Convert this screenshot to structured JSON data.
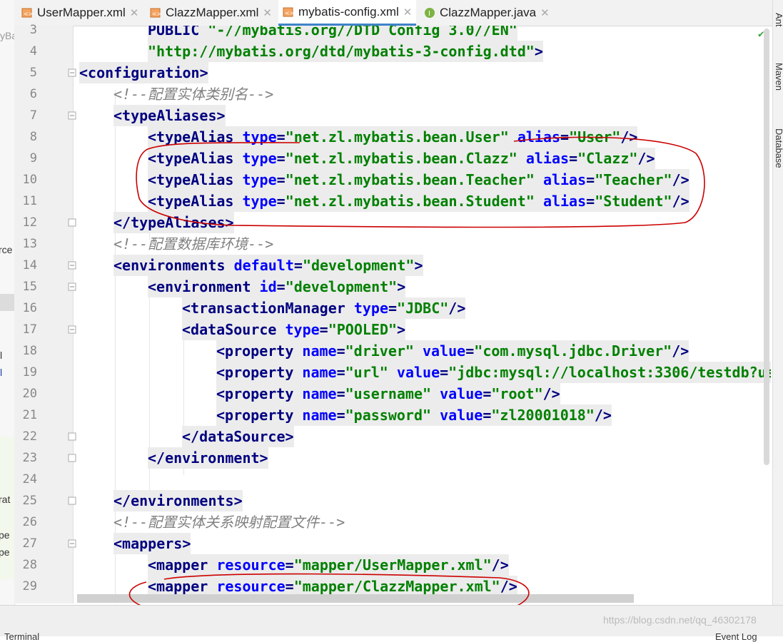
{
  "tabs": [
    {
      "label": "UserMapper.xml",
      "icon": "xml-file-icon",
      "active": false
    },
    {
      "label": "ClazzMapper.xml",
      "icon": "xml-file-icon",
      "active": false
    },
    {
      "label": "mybatis-config.xml",
      "icon": "xml-file-icon",
      "active": true
    },
    {
      "label": "ClazzMapper.java",
      "icon": "interface-file-icon",
      "active": false
    }
  ],
  "left_panel_fragments": [
    "yBa",
    "rce",
    "l",
    "l",
    "rat",
    "pe",
    "pe"
  ],
  "right_panel": {
    "tools": [
      "Ant",
      "Maven",
      "Database"
    ]
  },
  "line_numbers": [
    "3",
    "4",
    "5",
    "6",
    "7",
    "8",
    "9",
    "10",
    "11",
    "12",
    "13",
    "14",
    "15",
    "16",
    "17",
    "18",
    "19",
    "20",
    "21",
    "22",
    "23",
    "24",
    "25",
    "26",
    "27",
    "28",
    "29"
  ],
  "code": {
    "l3": {
      "public": "PUBLIC",
      "public_id": "\"-//mybatis.org//DTD Config 3.0//EN\""
    },
    "l4": {
      "dtd": "\"http://mybatis.org/dtd/mybatis-3-config.dtd\"",
      "close": ">"
    },
    "l5": {
      "open": "<configuration>"
    },
    "l6": {
      "comment": "<!--配置实体类别名-->"
    },
    "l7": {
      "open": "<typeAliases>"
    },
    "aliases": [
      {
        "tag": "<typeAlias",
        "type_attr": "type",
        "type_val": "\"net.zl.mybatis.bean.User\"",
        "alias_attr": "alias",
        "alias_val": "\"User\"",
        "end": "/>"
      },
      {
        "tag": "<typeAlias",
        "type_attr": "type",
        "type_val": "\"net.zl.mybatis.bean.Clazz\"",
        "alias_attr": "alias",
        "alias_val": "\"Clazz\"",
        "end": "/>"
      },
      {
        "tag": "<typeAlias",
        "type_attr": "type",
        "type_val": "\"net.zl.mybatis.bean.Teacher\"",
        "alias_attr": "alias",
        "alias_val": "\"Teacher\"",
        "end": "/>"
      },
      {
        "tag": "<typeAlias",
        "type_attr": "type",
        "type_val": "\"net.zl.mybatis.bean.Student\"",
        "alias_attr": "alias",
        "alias_val": "\"Student\"",
        "end": "/>"
      }
    ],
    "l12": {
      "close": "</typeAliases>"
    },
    "l13": {
      "comment": "<!--配置数据库环境-->"
    },
    "l14": {
      "tag": "<environments",
      "attr": "default",
      "val": "\"development\"",
      "end": ">"
    },
    "l15": {
      "tag": "<environment",
      "attr": "id",
      "val": "\"development\"",
      "end": ">"
    },
    "l16": {
      "tag": "<transactionManager",
      "attr": "type",
      "val": "\"JDBC\"",
      "end": "/>"
    },
    "l17": {
      "tag": "<dataSource",
      "attr": "type",
      "val": "\"POOLED\"",
      "end": ">"
    },
    "props": [
      {
        "tag": "<property",
        "name_attr": "name",
        "name_val": "\"driver\"",
        "value_attr": "value",
        "value_val": "\"com.mysql.jdbc.Driver\"",
        "end": "/>"
      },
      {
        "tag": "<property",
        "name_attr": "name",
        "name_val": "\"url\"",
        "value_attr": "value",
        "value_val": "\"jdbc:mysql://localhost:3306/testdb?us",
        "end": ""
      },
      {
        "tag": "<property",
        "name_attr": "name",
        "name_val": "\"username\"",
        "value_attr": "value",
        "value_val": "\"root\"",
        "end": "/>"
      },
      {
        "tag": "<property",
        "name_attr": "name",
        "name_val": "\"password\"",
        "value_attr": "value",
        "value_val": "\"zl20001018\"",
        "end": "/>"
      }
    ],
    "l22": {
      "close": "</dataSource>"
    },
    "l23": {
      "close": "</environment>"
    },
    "l25": {
      "close": "</environments>"
    },
    "l26": {
      "comment": "<!--配置实体关系映射配置文件-->"
    },
    "l27": {
      "open": "<mappers>"
    },
    "mappers": [
      {
        "tag": "<mapper",
        "attr": "resource",
        "val": "\"mapper/UserMapper.xml\"",
        "end": "/>"
      },
      {
        "tag": "<mapper",
        "attr": "resource",
        "val": "\"mapper/ClazzMapper.xml\"",
        "end": "/>"
      }
    ]
  },
  "colors": {
    "tag": "#000080",
    "attr": "#0000ff",
    "value": "#008000",
    "comment": "#808080",
    "annotation": "#cc0000",
    "active_tab": "#4083c9"
  },
  "bottom": {
    "terminal": "Terminal",
    "event_log": "Event Log"
  },
  "watermark": "https://blog.csdn.net/qq_46302178"
}
